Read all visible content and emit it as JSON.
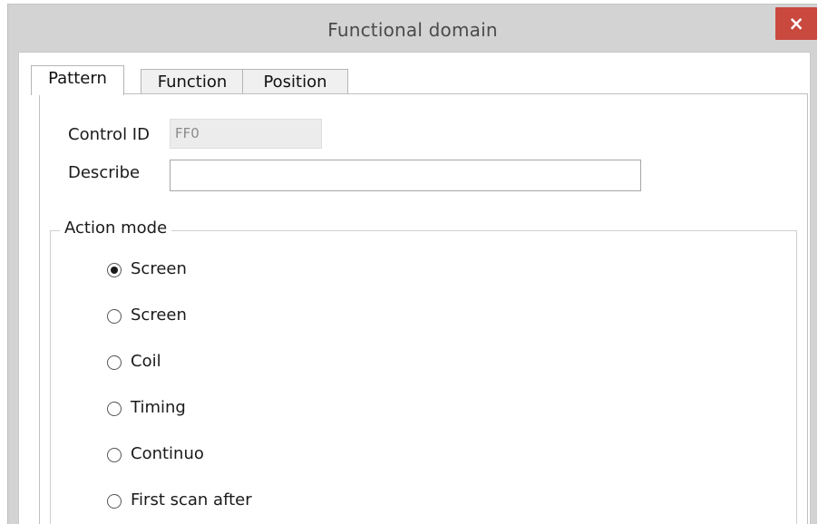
{
  "window": {
    "title": "Functional domain",
    "close_glyph": "×"
  },
  "tabs": [
    {
      "label": "Pattern",
      "active": true
    },
    {
      "label": "Function",
      "active": false
    },
    {
      "label": "Position",
      "active": false
    }
  ],
  "form": {
    "control_id_label": "Control ID",
    "control_id_value": "FF0",
    "describe_label": "Describe",
    "describe_value": ""
  },
  "action_mode": {
    "legend": "Action mode",
    "selected_index": 0,
    "options": [
      {
        "label": "Screen"
      },
      {
        "label": "Screen"
      },
      {
        "label": "Coil"
      },
      {
        "label": "Timing"
      },
      {
        "label": "Continuo"
      },
      {
        "label": "First scan after"
      }
    ]
  },
  "colors": {
    "titlebar": "#d3d3d3",
    "close_button": "#c9493f",
    "client_bg": "#ffffff"
  },
  "icons": {
    "close": "close-icon",
    "radio": "radio-button-icon"
  }
}
